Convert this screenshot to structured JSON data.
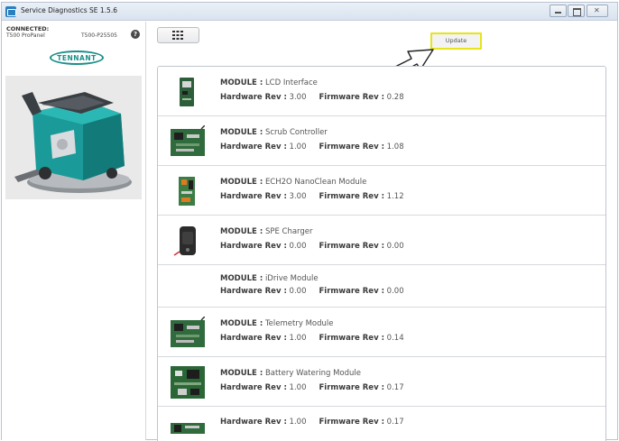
{
  "window": {
    "title": "Service Diagnostics SE 1.5.6",
    "min_icon": "minimize-icon",
    "max_icon": "maximize-icon",
    "close_icon": "close-icon"
  },
  "connection": {
    "status": "CONNECTED:",
    "model": "T500 ProPanel",
    "serial": "T500-P25505",
    "help_icon": "help-icon"
  },
  "brand": {
    "logo_text": "TENNANT"
  },
  "toolbar": {
    "grid_icon": "grid-menu-icon",
    "update_label": "Update"
  },
  "labels": {
    "module": "MODULE :",
    "hardware": "Hardware Rev :",
    "firmware": "Firmware Rev :"
  },
  "modules": [
    {
      "name": "LCD Interface",
      "hardware_rev": "3.00",
      "firmware_rev": "0.28"
    },
    {
      "name": "Scrub Controller",
      "hardware_rev": "1.00",
      "firmware_rev": "1.08"
    },
    {
      "name": "ECH2O NanoClean Module",
      "hardware_rev": "3.00",
      "firmware_rev": "1.12"
    },
    {
      "name": "SPE Charger",
      "hardware_rev": "0.00",
      "firmware_rev": "0.00"
    },
    {
      "name": "iDrive Module",
      "hardware_rev": "0.00",
      "firmware_rev": "0.00"
    },
    {
      "name": "Telemetry Module",
      "hardware_rev": "1.00",
      "firmware_rev": "0.14"
    },
    {
      "name": "Battery Watering Module",
      "hardware_rev": "1.00",
      "firmware_rev": "0.17"
    },
    {
      "name": "",
      "hardware_rev": "1.00",
      "firmware_rev": "0.17"
    }
  ],
  "colors": {
    "accent_teal": "#1c8f8a",
    "update_highlight": "#e5e519",
    "circuit_green": "#2f6b3c"
  }
}
